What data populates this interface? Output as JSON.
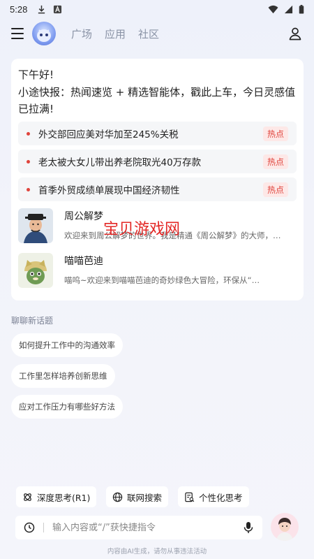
{
  "status_bar": {
    "time": "5:28",
    "icons": [
      "download-icon",
      "font-a-icon",
      "wifi-icon",
      "signal-icon",
      "battery-icon"
    ]
  },
  "nav": {
    "tabs": [
      {
        "label": "广场"
      },
      {
        "label": "应用"
      },
      {
        "label": "社区"
      }
    ]
  },
  "main_card": {
    "greeting": "下午好!",
    "intro": "小途快报：热闻速览 + 精选智能体，戳此上车，今日灵感值已拉满!",
    "news": [
      {
        "title": "外交部回应美对华加至245%关税",
        "badge": "热点"
      },
      {
        "title": "老太被大女儿带出养老院取光40万存款",
        "badge": "热点"
      },
      {
        "title": "首季外贸成绩单展现中国经济韧性",
        "badge": "热点"
      }
    ],
    "agents": [
      {
        "name": "周公解梦",
        "desc": "欢迎来到周公解梦的世界。我是精通《周公解梦》的大师，…"
      },
      {
        "name": "喵喵芭迪",
        "desc": "喵呜~欢迎来到喵喵芭迪的奇妙绿色大冒险，环保从“…"
      }
    ]
  },
  "watermark": "宝贝游戏网",
  "topics": {
    "label": "聊聊新话题",
    "items": [
      "如何提升工作中的沟通效率",
      "工作里怎样培养创新思维",
      "应对工作压力有哪些好方法"
    ]
  },
  "actions": {
    "deep_think": "深度思考(R1)",
    "web_search": "联网搜索",
    "personal_think": "个性化思考"
  },
  "input": {
    "placeholder": "输入内容或“/”获快捷指令"
  },
  "disclaimer": "内容由AI生成，请勿从事违法活动",
  "colors": {
    "hot": "#e0443c",
    "hot_bg": "#fde8e7",
    "nav_inactive": "#8a93a6",
    "watermark": "#e32826"
  }
}
